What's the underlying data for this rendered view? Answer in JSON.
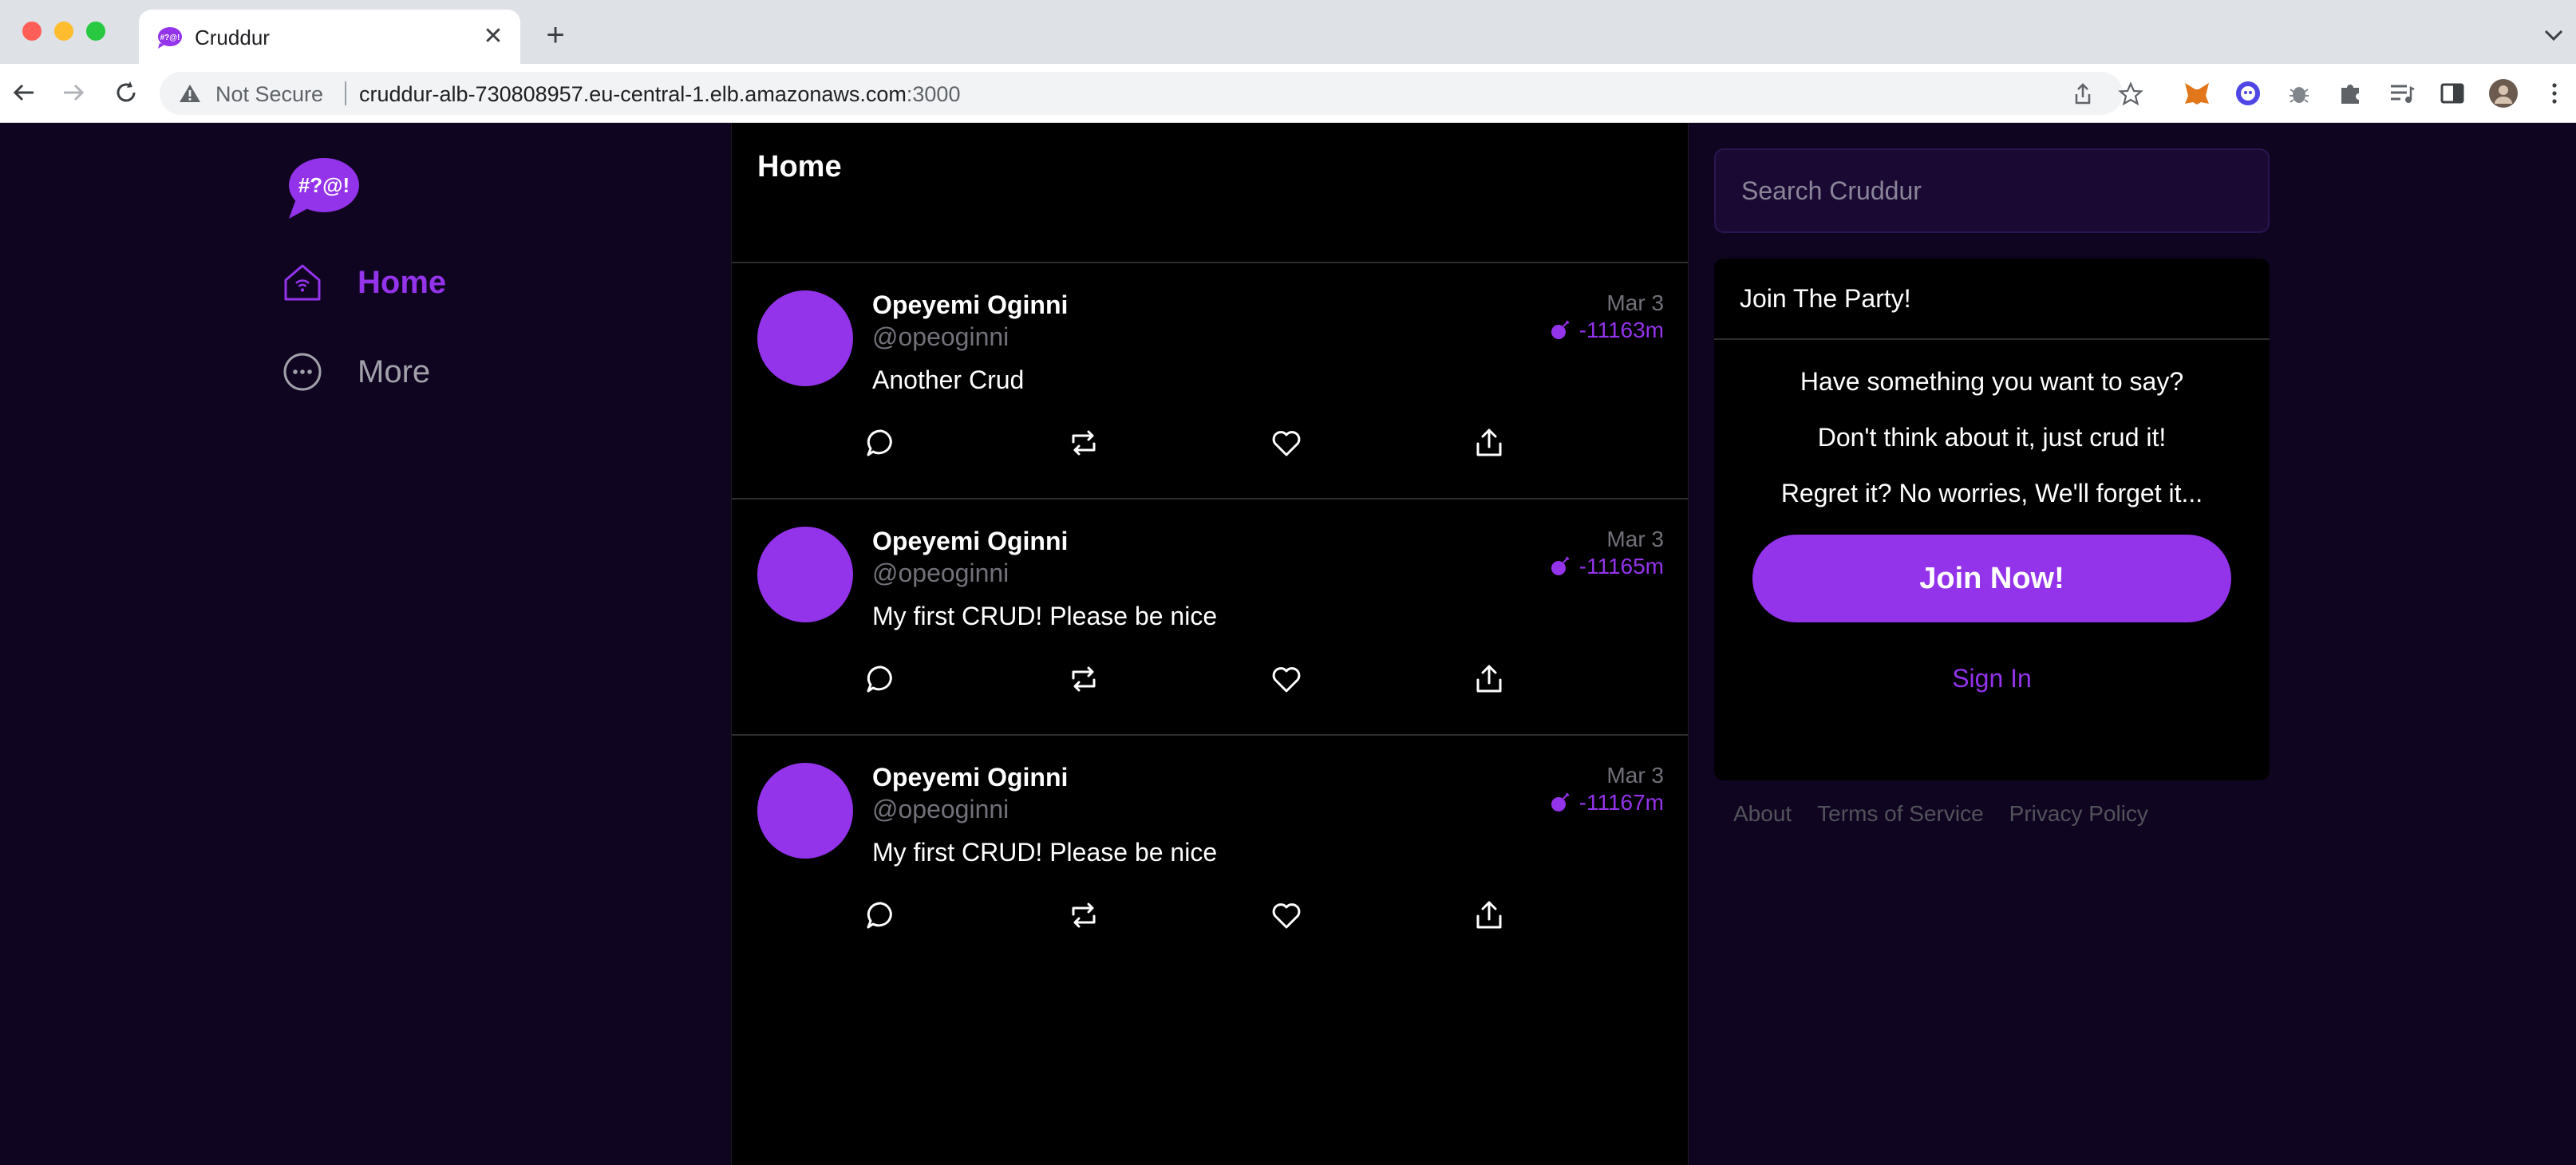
{
  "browser": {
    "tab_title": "Cruddur",
    "security_label": "Not Secure",
    "url_host": "cruddur-alb-730808957.eu-central-1.elb.amazonaws.com",
    "url_port": ":3000"
  },
  "sidebar": {
    "items": [
      {
        "label": "Home",
        "icon": "home-icon"
      },
      {
        "label": "More",
        "icon": "more-icon"
      }
    ]
  },
  "feed": {
    "title": "Home",
    "posts": [
      {
        "name": "Opeyemi Oginni",
        "handle": "@opeoginni",
        "text": "Another Crud",
        "date": "Mar 3",
        "expiry": "-11163m"
      },
      {
        "name": "Opeyemi Oginni",
        "handle": "@opeoginni",
        "text": "My first CRUD! Please be nice",
        "date": "Mar 3",
        "expiry": "-11165m"
      },
      {
        "name": "Opeyemi Oginni",
        "handle": "@opeoginni",
        "text": "My first CRUD! Please be nice",
        "date": "Mar 3",
        "expiry": "-11167m"
      }
    ]
  },
  "search": {
    "placeholder": "Search Cruddur"
  },
  "join": {
    "title": "Join The Party!",
    "lines": [
      "Have something you want to say?",
      "Don't think about it, just crud it!",
      "Regret it? No worries, We'll forget it..."
    ],
    "button": "Join Now!",
    "signin": "Sign In"
  },
  "footer": {
    "links": [
      "About",
      "Terms of Service",
      "Privacy Policy"
    ]
  },
  "colors": {
    "accent": "#9333ea",
    "page_bg": "#0f0520",
    "feed_bg": "#000000"
  }
}
